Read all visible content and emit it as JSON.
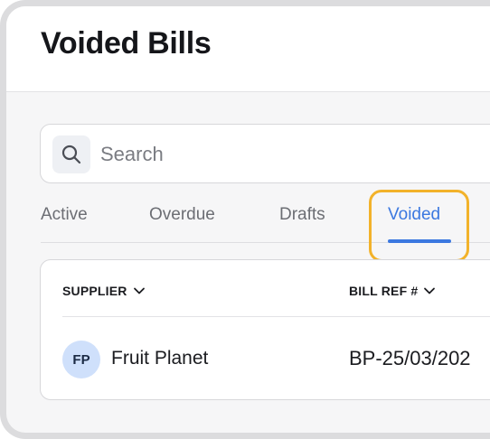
{
  "header": {
    "title": "Voided Bills"
  },
  "search": {
    "placeholder": "Search",
    "value": "",
    "icon": "search-icon"
  },
  "tabs": [
    {
      "label": "Active",
      "selected": false
    },
    {
      "label": "Overdue",
      "selected": false
    },
    {
      "label": "Drafts",
      "selected": false
    },
    {
      "label": "Voided",
      "selected": true
    }
  ],
  "table": {
    "columns": [
      {
        "label": "SUPPLIER",
        "icon": "chevron-down-icon"
      },
      {
        "label": "BILL REF #",
        "icon": "chevron-down-icon"
      }
    ],
    "rows": [
      {
        "avatar_initials": "FP",
        "supplier": "Fruit Planet",
        "bill_ref": "BP-25/03/202"
      }
    ]
  },
  "colors": {
    "accent": "#3b78e0",
    "focus_ring": "#f2b22a",
    "avatar_bg": "#cfe0fb"
  }
}
